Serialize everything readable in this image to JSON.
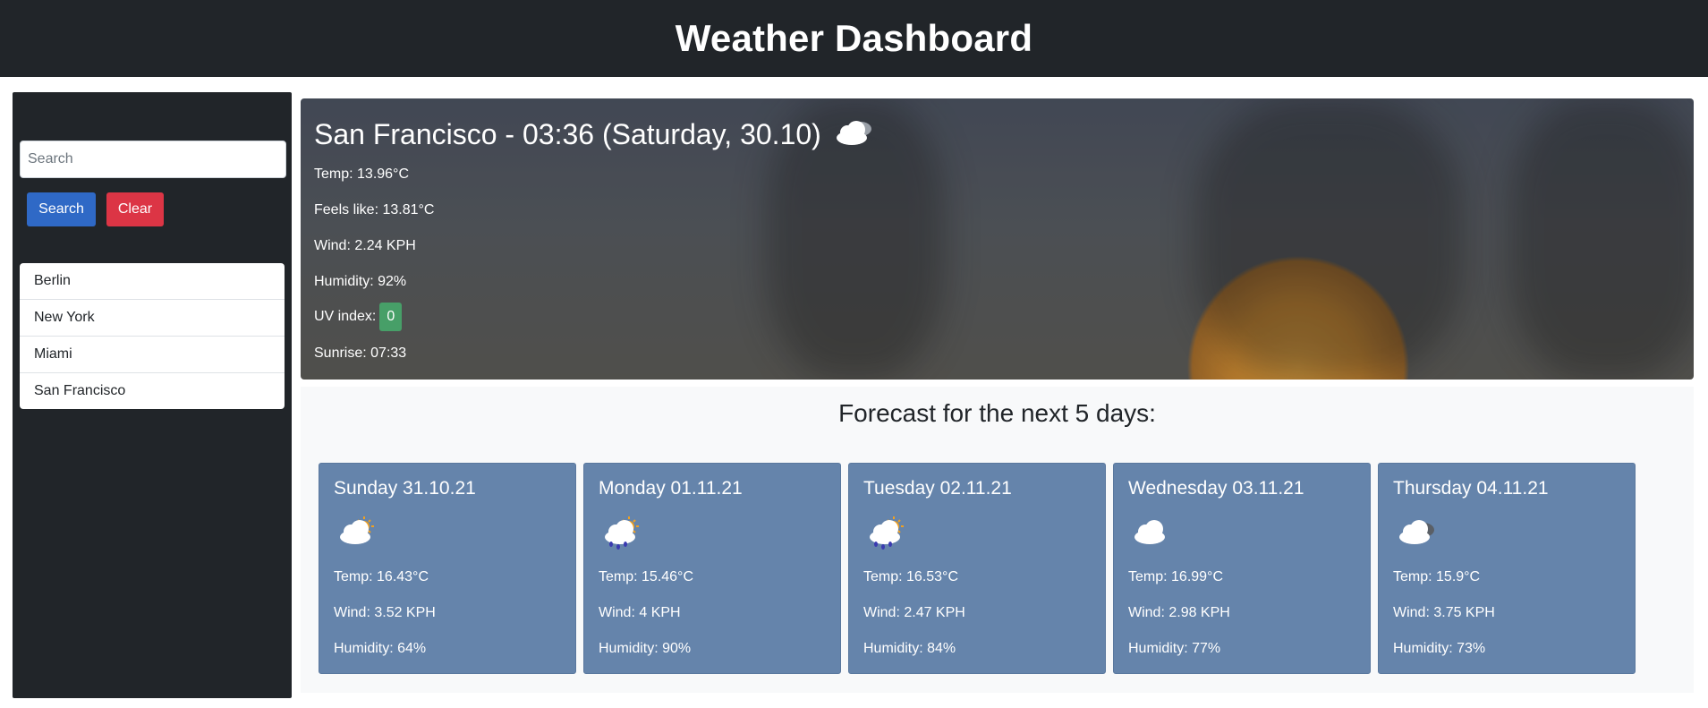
{
  "header": {
    "title": "Weather Dashboard"
  },
  "sidebar": {
    "search": {
      "placeholder": "Search",
      "value": ""
    },
    "search_button": "Search",
    "clear_button": "Clear",
    "history": [
      {
        "label": "Berlin"
      },
      {
        "label": "New York"
      },
      {
        "label": "Miami"
      },
      {
        "label": "San Francisco"
      }
    ]
  },
  "current": {
    "title": "San Francisco - 03:36 (Saturday, 30.10)",
    "icon": "partly-cloudy-night-icon",
    "temp": "Temp: 13.96°C",
    "feels_like": "Feels like: 13.81°C",
    "wind": "Wind: 2.24 KPH",
    "humidity": "Humidity: 92%",
    "uv_label": "UV index:",
    "uv_value": "0",
    "sunrise": "Sunrise: 07:33"
  },
  "forecast": {
    "title": "Forecast for the next 5 days:",
    "days": [
      {
        "title": "Sunday 31.10.21",
        "icon": "cloud-sun-icon",
        "temp": "Temp: 16.43°C",
        "wind": "Wind: 3.52 KPH",
        "humidity": "Humidity: 64%"
      },
      {
        "title": "Monday 01.11.21",
        "icon": "rain-sun-icon",
        "temp": "Temp: 15.46°C",
        "wind": "Wind: 4 KPH",
        "humidity": "Humidity: 90%"
      },
      {
        "title": "Tuesday 02.11.21",
        "icon": "rain-sun-icon",
        "temp": "Temp: 16.53°C",
        "wind": "Wind: 2.47 KPH",
        "humidity": "Humidity: 84%"
      },
      {
        "title": "Wednesday 03.11.21",
        "icon": "cloud-icon",
        "temp": "Temp: 16.99°C",
        "wind": "Wind: 2.98 KPH",
        "humidity": "Humidity: 77%"
      },
      {
        "title": "Thursday 04.11.21",
        "icon": "cloud-dark-icon",
        "temp": "Temp: 15.9°C",
        "wind": "Wind: 3.75 KPH",
        "humidity": "Humidity: 73%"
      }
    ]
  },
  "colors": {
    "header_bg": "#212529",
    "card_bg": "#6584ab",
    "search_button": "#2f69c6",
    "clear_button": "#dc3545",
    "uv_badge": "#479f68"
  }
}
